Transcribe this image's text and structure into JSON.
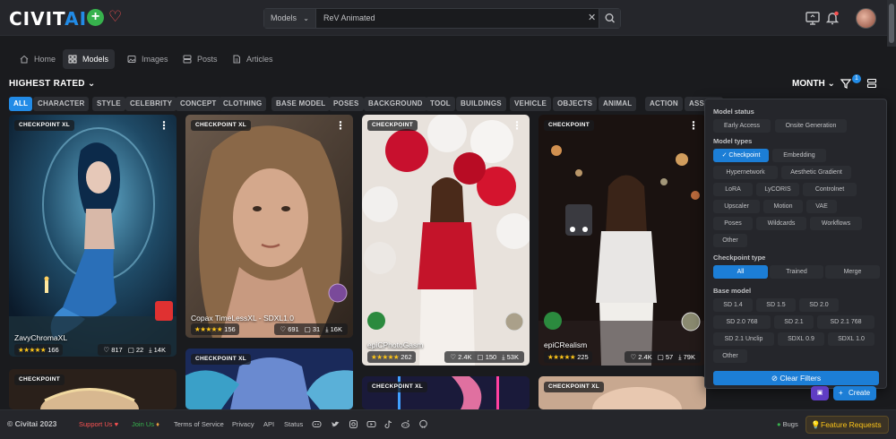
{
  "header": {
    "logo_main": "CIVIT",
    "logo_ai": "AI",
    "search_type": "Models",
    "search_value": "ReV Animated"
  },
  "nav": {
    "items": [
      {
        "label": "Home"
      },
      {
        "label": "Models"
      },
      {
        "label": "Images"
      },
      {
        "label": "Posts"
      },
      {
        "label": "Articles"
      }
    ]
  },
  "sort": {
    "label": "HIGHEST RATED",
    "period": "MONTH",
    "filter_count": "1"
  },
  "tags": [
    "ALL",
    "CHARACTER",
    "STYLE",
    "CELEBRITY",
    "CONCEPT",
    "CLOTHING",
    "BASE MODEL",
    "POSES",
    "BACKGROUND",
    "TOOL",
    "BUILDINGS",
    "VEHICLE",
    "OBJECTS",
    "ANIMAL",
    "ACTION",
    "ASSETS"
  ],
  "cards": [
    {
      "badge": "CHECKPOINT XL",
      "title": "ZavyChromaXL",
      "rating": "166",
      "likes": "817",
      "comments": "22",
      "downloads": "14K"
    },
    {
      "badge": "CHECKPOINT XL",
      "title": "Copax TimeLessXL - SDXL1.0",
      "rating": "156",
      "likes": "691",
      "comments": "31",
      "downloads": "16K"
    },
    {
      "badge": "CHECKPOINT",
      "title": "epiCPhotoGasm",
      "rating": "262",
      "likes": "2.4K",
      "comments": "150",
      "downloads": "53K"
    },
    {
      "badge": "CHECKPOINT",
      "title": "epiCRealism",
      "rating": "225",
      "likes": "2.4K",
      "comments": "57",
      "downloads": "79K"
    }
  ],
  "row2_badges": [
    "CHECKPOINT",
    "CHECKPOINT XL",
    "CHECKPOINT XL",
    "CHECKPOINT XL"
  ],
  "filters": {
    "model_status": {
      "title": "Model status",
      "options": [
        "Early Access",
        "Onsite Generation"
      ]
    },
    "model_types": {
      "title": "Model types",
      "selected": "Checkpoint",
      "options": [
        "Checkpoint",
        "Embedding",
        "Hypernetwork",
        "Aesthetic Gradient",
        "LoRA",
        "LyCORIS",
        "Controlnet",
        "Upscaler",
        "Motion",
        "VAE",
        "Poses",
        "Wildcards",
        "Workflows",
        "Other"
      ]
    },
    "checkpoint_type": {
      "title": "Checkpoint type",
      "selected": "All",
      "options": [
        "All",
        "Trained",
        "Merge"
      ]
    },
    "base_model": {
      "title": "Base model",
      "options": [
        "SD 1.4",
        "SD 1.5",
        "SD 2.0",
        "SD 2.0 768",
        "SD 2.1",
        "SD 2.1 768",
        "SD 2.1 Unclip",
        "SDXL 0.9",
        "SDXL 1.0",
        "Other"
      ]
    },
    "clear_label": "Clear Filters"
  },
  "floating": {
    "create_label": "Create"
  },
  "footer": {
    "copyright": "© Civitai 2023",
    "support": "Support Us",
    "join": "Join Us",
    "tos": "Terms of Service",
    "privacy": "Privacy",
    "api": "API",
    "status": "Status",
    "bugs": "Bugs",
    "feature": "Feature Requests"
  },
  "colors": {
    "accent": "#228be6",
    "bg": "#1a1b1e",
    "surface": "#25262b",
    "star": "#fcc419",
    "success": "#37b24d"
  }
}
